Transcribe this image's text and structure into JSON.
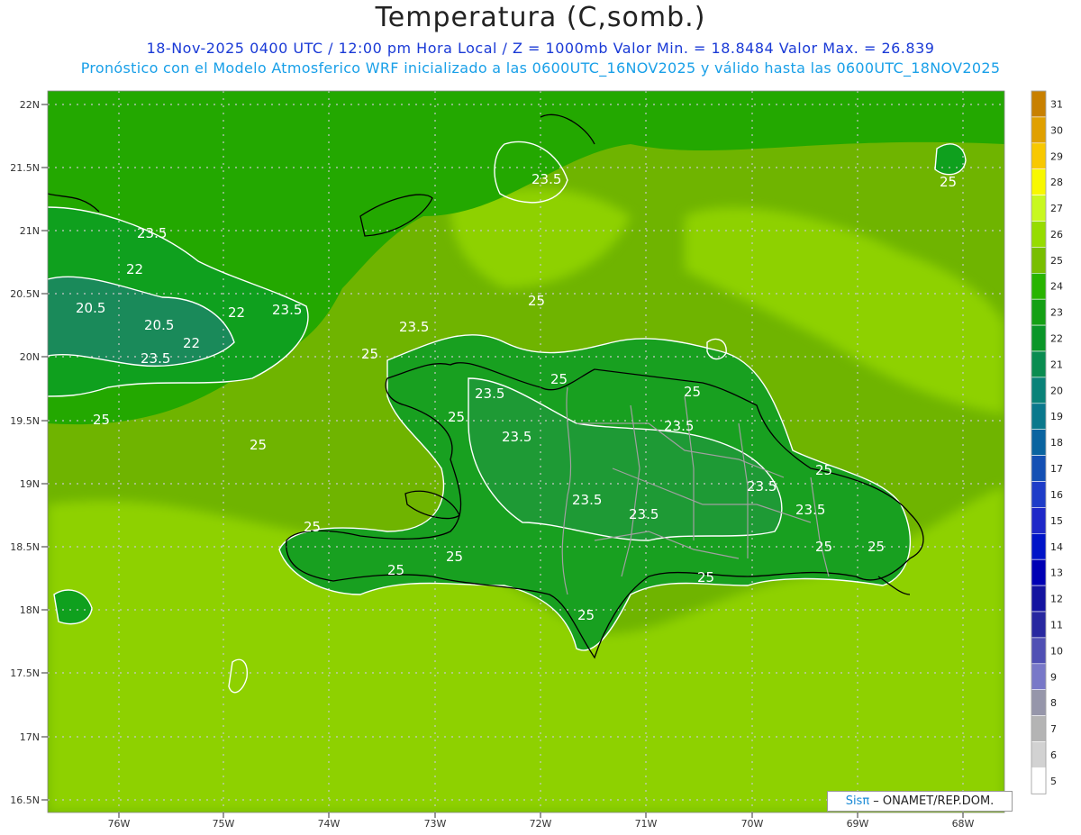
{
  "header": {
    "title": "Temperatura (C,somb.)",
    "line1": "18-Nov-2025 0400 UTC / 12:00 pm Hora Local / Z = 1000mb   Valor Min. = 18.8484  Valor Max. = 26.839",
    "line2": "Pronóstico con el Modelo Atmosferico WRF inicializado a las 0600UTC_16NOV2025 y válido hasta las  0600UTC_18NOV2025"
  },
  "axes": {
    "lat_labels": [
      "22N",
      "21.5N",
      "21N",
      "20.5N",
      "20N",
      "19.5N",
      "19N",
      "18.5N",
      "18N",
      "17.5N",
      "17N",
      "16.5N"
    ],
    "lon_labels": [
      "76W",
      "75W",
      "74W",
      "73W",
      "72W",
      "71W",
      "70W",
      "69W",
      "68W"
    ]
  },
  "colorbar": {
    "values": [
      "31",
      "30",
      "29",
      "28",
      "27",
      "26",
      "25",
      "24",
      "23",
      "22",
      "21",
      "20",
      "19",
      "18",
      "17",
      "16",
      "15",
      "14",
      "13",
      "12",
      "11",
      "10",
      "9",
      "8",
      "7",
      "6",
      "5"
    ],
    "colors": [
      "#c88000",
      "#e0a000",
      "#f8c800",
      "#f8f800",
      "#c8f820",
      "#96dc00",
      "#78be00",
      "#28b400",
      "#14a014",
      "#0a9628",
      "#0a8c50",
      "#0a8278",
      "#0a788c",
      "#0a64a0",
      "#1450b4",
      "#1e3cc8",
      "#1e28c8",
      "#0014c8",
      "#0000b4",
      "#1414a0",
      "#2828a0",
      "#5050b4",
      "#7878c8",
      "#9696aa",
      "#b4b4b4",
      "#d2d2d2",
      "#ffffff"
    ]
  },
  "contour_labels": [
    "23.5",
    "25",
    "22",
    "20.5",
    "20.5",
    "22",
    "22",
    "23.5",
    "23.5",
    "25",
    "25",
    "25",
    "23.5",
    "25",
    "23.5",
    "25",
    "23.5",
    "23.5",
    "25",
    "23.5",
    "23.5",
    "25",
    "23.5",
    "23.5",
    "25",
    "25",
    "25",
    "25",
    "25",
    "23.5",
    "25",
    "25",
    "25"
  ],
  "credit": {
    "sis": "Sisπ",
    "org": " – ONAMET/REP.DOM."
  }
}
